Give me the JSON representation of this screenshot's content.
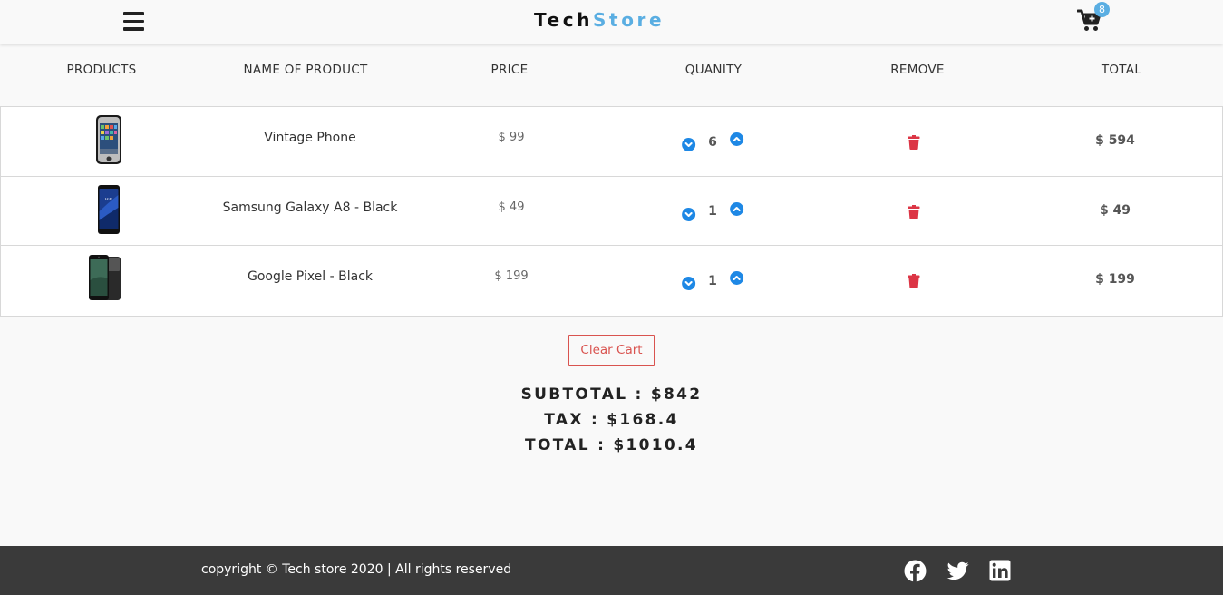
{
  "header": {
    "logo_main": "Tech",
    "logo_accent": "Store",
    "cart_count": "8"
  },
  "columns": [
    "PRODUCTS",
    "NAME OF PRODUCT",
    "PRICE",
    "QUANITY",
    "REMOVE",
    "TOTAL"
  ],
  "items": [
    {
      "name": "Vintage Phone",
      "price": "$ 99",
      "quantity": "6",
      "total": "$ 594",
      "image": "vintage-phone-image"
    },
    {
      "name": "Samsung Galaxy A8 - Black",
      "price": "$ 49",
      "quantity": "1",
      "total": "$ 49",
      "image": "samsung-phone-image"
    },
    {
      "name": "Google Pixel - Black",
      "price": "$ 199",
      "quantity": "1",
      "total": "$ 199",
      "image": "pixel-phone-image"
    }
  ],
  "clear_cart_label": "Clear Cart",
  "summary": {
    "subtotal": "SUBTOTAL : $842",
    "tax": "TAX : $168.4",
    "total": "TOTAL : $1010.4"
  },
  "footer": {
    "copyright": "copyright © Tech store 2020 | All rights reserved",
    "social": [
      "facebook-icon",
      "twitter-icon",
      "linkedin-icon"
    ]
  },
  "colors": {
    "accent": "#5aaee2",
    "danger": "#dc3545",
    "qty_button": "#1e88e5",
    "footer_bg": "#3a3a3a"
  }
}
